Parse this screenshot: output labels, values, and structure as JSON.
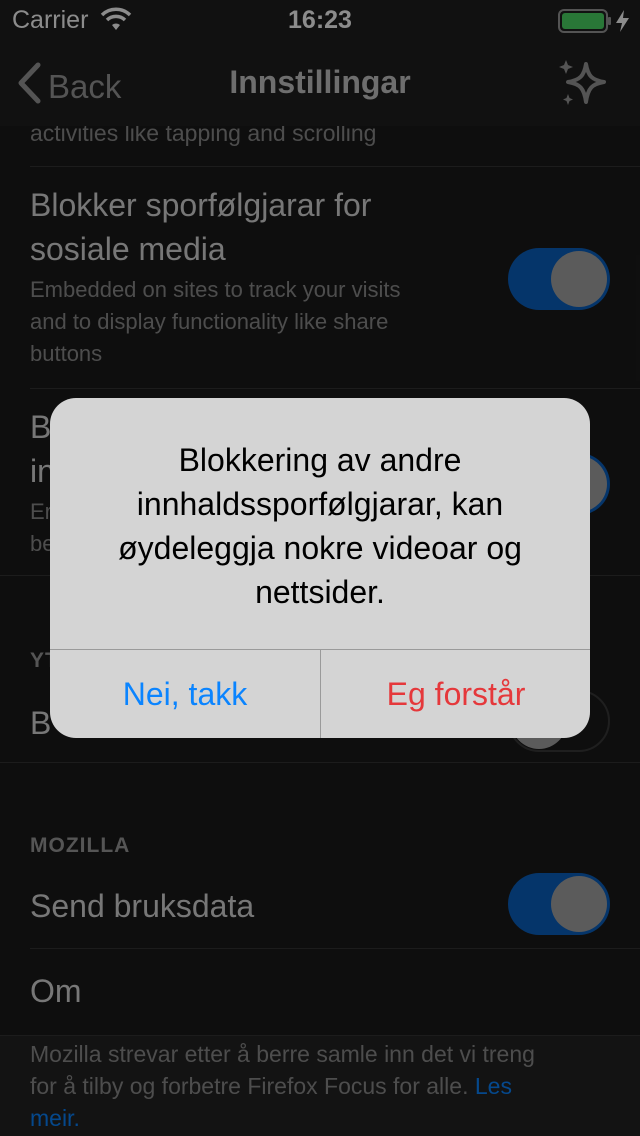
{
  "status_bar": {
    "carrier": "Carrier",
    "time": "16:23"
  },
  "nav": {
    "back_label": "Back",
    "title": "Innstillingar",
    "action_icon": "sparkle-icon"
  },
  "rows": {
    "partial_sub": "activities like tapping and scrolling",
    "social": {
      "title_line1": "Blokker sporfølgjarar for",
      "title_line2": "sosiale media",
      "sub_line1": "Embedded on sites to track your visits",
      "sub_line2": "and to display functionality like share",
      "sub_line3": "buttons",
      "toggle_on": true
    },
    "other_content": {
      "title_line1": "B",
      "title_line2": "in",
      "sub_line1": "Er",
      "sub_line2": "be",
      "toggle_on": true
    },
    "perf_section_partial": "YT",
    "perf_row_partial": "B",
    "perf_toggle_on": false
  },
  "mozilla": {
    "section_header": "MOZILLA",
    "send_usage": "Send bruksdata",
    "send_usage_on": true,
    "about": "Om",
    "footer_line1": "Mozilla strevar etter å berre samle inn det vi treng",
    "footer_line2": "for å tilby og forbetre Firefox Focus for alle.",
    "footer_link_part1": "Les",
    "footer_link_part2": "meir."
  },
  "alert": {
    "line1": "Blokkering av andre",
    "line2": "innhaldssporfølgjarar, kan",
    "line3": "øydeleggja nokre videoar og",
    "line4": "nettsider.",
    "cancel_label": "Nei, takk",
    "confirm_label": "Eg forstår"
  },
  "colors": {
    "accent_blue": "#0a84ff",
    "destructive_red": "#e5383b",
    "toggle_on": "#0a62c2"
  }
}
